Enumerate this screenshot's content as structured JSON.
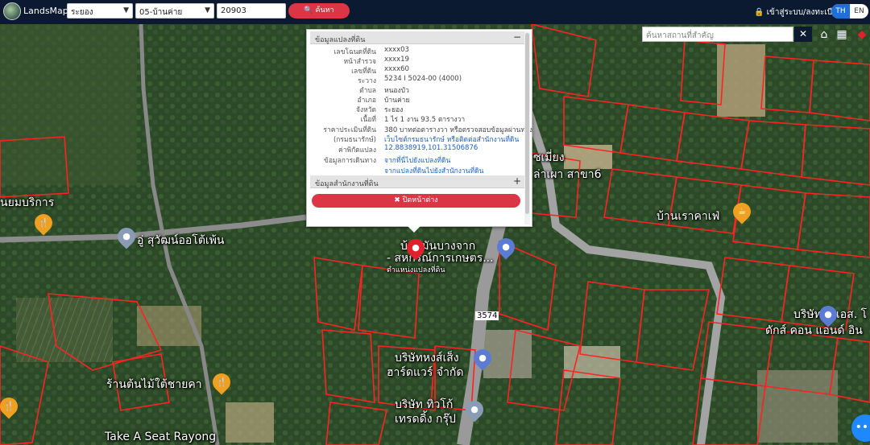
{
  "app": {
    "name": "LandsMaps"
  },
  "toolbar": {
    "province": "ระยอง",
    "district": "05-บ้านค่าย",
    "parcel_no": "20903",
    "search_label": "🔍 ค้นหา",
    "login_label": "🔒 เข้าสู่ระบบ/ลงทะเบียน",
    "lang_th": "TH",
    "lang_en": "EN"
  },
  "map": {
    "place_search_placeholder": "ค้นหาสถานที่สำคัญ",
    "clear_icon": "close-icon",
    "controls": [
      "home-icon",
      "grid-icon",
      "layers-icon"
    ],
    "labels": [
      {
        "id": "lbl-1",
        "text": "นยมบริการ"
      },
      {
        "id": "lbl-2",
        "text": "อู่ สุวัฒน์ออโต้เพ้น"
      },
      {
        "id": "lbl-3",
        "text": "ร้านต้นไม้ใต้ชายคา"
      },
      {
        "id": "lbl-4",
        "text": "Take A Seat Rayong"
      },
      {
        "id": "lbl-5",
        "text": "บ้านเราคาเฟ่"
      },
      {
        "id": "lbl-6",
        "text": "ซเมี่ยง"
      },
      {
        "id": "lbl-7",
        "text": "ล่าเผา สาขา6"
      },
      {
        "id": "lbl-8",
        "text": "บ้านมันบางจาก"
      },
      {
        "id": "lbl-9",
        "text": "- สหกรณ์การเกษตร..."
      },
      {
        "id": "lbl-10",
        "text": "ตำแหน่งแปลงที่ดิน"
      },
      {
        "id": "lbl-11",
        "text": "บริษัทหงส์เส็ง"
      },
      {
        "id": "lbl-12",
        "text": "ฮาร์ดแวร์ จำกัด"
      },
      {
        "id": "lbl-13",
        "text": "บริษัท ทิวโก้"
      },
      {
        "id": "lbl-14",
        "text": "เทรดดิ้ง กรุ๊ป"
      },
      {
        "id": "lbl-15",
        "text": "บริษัท พี.เอส. โ"
      },
      {
        "id": "lbl-16",
        "text": "ดักส์ คอน แอนด์ อิน"
      },
      {
        "id": "lbl-17",
        "text": "3574"
      }
    ]
  },
  "panel": {
    "section1_title": "ข้อมูลแปลงที่ดิน",
    "section1_toggle": "−",
    "rows": [
      {
        "label": "เลขโฉนดที่ดิน",
        "value": "xxxx03"
      },
      {
        "label": "หน้าสำรวจ",
        "value": "xxxx19"
      },
      {
        "label": "เลขที่ดิน",
        "value": "xxxx60"
      },
      {
        "label": "ระวาง",
        "value": "5234 I 5024-00 (4000)"
      },
      {
        "label": "ตำบล",
        "value": "หนองบัว"
      },
      {
        "label": "อำเภอ",
        "value": "บ้านค่าย"
      },
      {
        "label": "จังหวัด",
        "value": "ระยอง"
      },
      {
        "label": "เนื้อที่",
        "value": "1 ไร่ 1 งาน 93.5 ตารางวา"
      },
      {
        "label": "ราคาประเมินที่ดิน",
        "value": "380 บาทต่อตารางวา หรือตรวจสอบข้อมูลผ่านทาง"
      },
      {
        "label": "(กรมธนารักษ์)",
        "value": "เว็บไซต์กรมธนารักษ์ หรือติดต่อสำนักงานที่ดิน",
        "link": true
      },
      {
        "label": "ค่าพิกัดแปลง",
        "value": "12.8838919,101.31506876",
        "link": true
      },
      {
        "label": "ข้อมูลการเดินทาง",
        "value": "จากที่นี่ไปยังแปลงที่ดิน",
        "link": true
      },
      {
        "label": "",
        "value": "จากแปลงที่ดินไปยังสำนักงานที่ดิน",
        "link": true
      }
    ],
    "section2_title": "ข้อมูลสำนักงานที่ดิน",
    "section2_toggle": "+",
    "close_label": "✖ ปิดหน้าต่าง"
  },
  "colors": {
    "topbar": "#0b1a30",
    "accent_red": "#dc3545",
    "parcel_lines": "#ff2222",
    "lang_active": "#1e6fd9"
  }
}
